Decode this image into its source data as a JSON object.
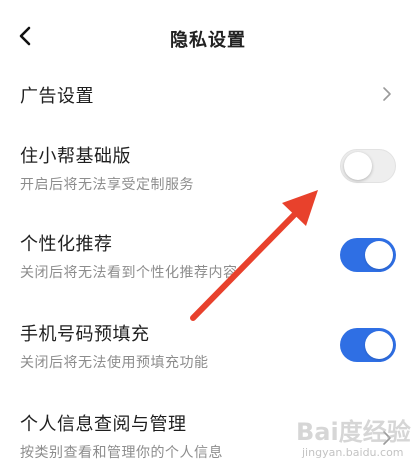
{
  "header": {
    "title": "隐私设置",
    "back_icon": "chevron-left-icon"
  },
  "rows": [
    {
      "title": "广告设置",
      "control": "chevron-right-icon"
    },
    {
      "title": "住小帮基础版",
      "subtitle": "开启后将无法享受定制服务",
      "toggle_on": false
    },
    {
      "title": "个性化推荐",
      "subtitle": "关闭后将无法看到个性化推荐内容",
      "toggle_on": true
    },
    {
      "title": "手机号码预填充",
      "subtitle": "关闭后将无法使用预填充功能",
      "toggle_on": true
    },
    {
      "title": "个人信息查阅与管理",
      "subtitle": "按类别查看和管理你的个人信息",
      "control": "chevron-right-icon"
    }
  ],
  "colors": {
    "toggle_on": "#2f6fe4",
    "toggle_off": "#eeeeee",
    "arrow": "#e8412c",
    "subtitle": "#8d8d8d"
  },
  "watermark": {
    "text": "Bai度经验",
    "sub": "jingyan.baidu.com"
  }
}
